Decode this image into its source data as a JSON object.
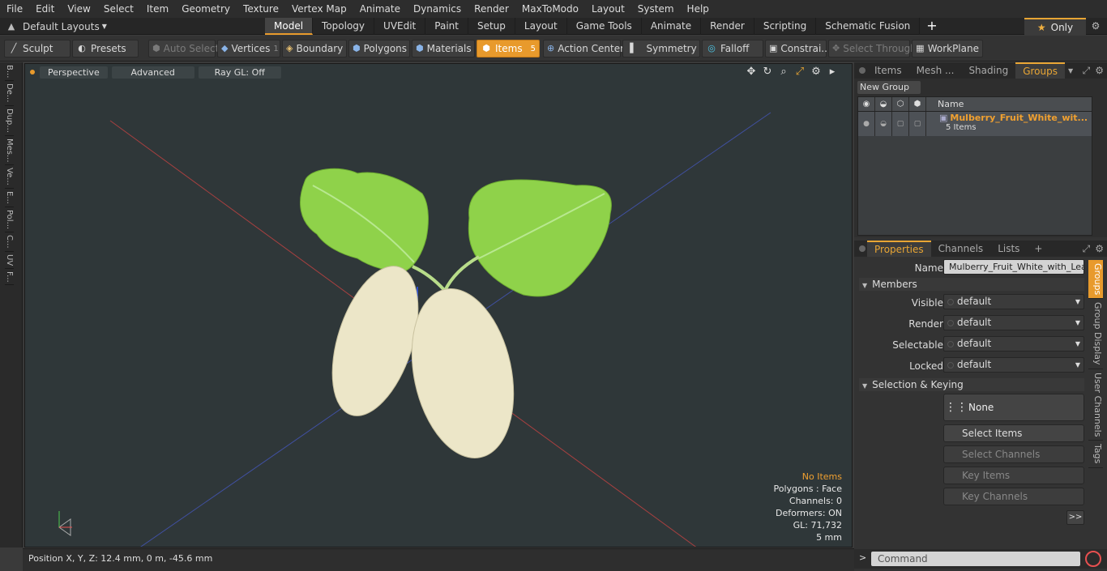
{
  "menubar": [
    "File",
    "Edit",
    "View",
    "Select",
    "Item",
    "Geometry",
    "Texture",
    "Vertex Map",
    "Animate",
    "Dynamics",
    "Render",
    "MaxToModo",
    "Layout",
    "System",
    "Help"
  ],
  "layouts": {
    "label": "Default Layouts"
  },
  "tabs": [
    {
      "label": "Model",
      "active": true
    },
    {
      "label": "Topology"
    },
    {
      "label": "UVEdit"
    },
    {
      "label": "Paint"
    },
    {
      "label": "Setup"
    },
    {
      "label": "Layout"
    },
    {
      "label": "Game Tools"
    },
    {
      "label": "Animate"
    },
    {
      "label": "Render"
    },
    {
      "label": "Scripting"
    },
    {
      "label": "Schematic Fusion"
    }
  ],
  "only_label": "Only",
  "toolbar": {
    "sculpt": "Sculpt",
    "presets": "Presets",
    "auto_select": "Auto Select",
    "vertices": "Vertices",
    "vertices_count": "1",
    "boundary": "Boundary",
    "polygons": "Polygons",
    "materials": "Materials",
    "items": "Items",
    "items_count": "5",
    "action_center": "Action Center",
    "symmetry": "Symmetry",
    "falloff": "Falloff",
    "constraints": "Constrai...",
    "select_through": "Select Through",
    "workplane": "WorkPlane"
  },
  "left_tabs": [
    "B...",
    "De...",
    "Dup...",
    "Mes...",
    "Ve...",
    "E...",
    "Pol...",
    "C...",
    "UV",
    "F..."
  ],
  "viewport": {
    "perspective": "Perspective",
    "advanced": "Advanced",
    "raygl": "Ray GL: Off",
    "info": {
      "no_items": "No Items",
      "polygons": "Polygons : Face",
      "channels": "Channels: 0",
      "deformers": "Deformers: ON",
      "gl": "GL: 71,732",
      "scale": "5 mm"
    }
  },
  "status": {
    "position": "Position X, Y, Z:   12.4 mm, 0 m, -45.6 mm"
  },
  "top_panel_tabs": [
    {
      "label": "Items"
    },
    {
      "label": "Mesh ..."
    },
    {
      "label": "Shading"
    },
    {
      "label": "Groups",
      "active": true
    }
  ],
  "groups": {
    "new_group": "New Group",
    "column_name": "Name",
    "item": {
      "name": "Mulberry_Fruit_White_wit...",
      "count": "5 Items"
    }
  },
  "props_tabs": [
    {
      "label": "Properties",
      "active": true
    },
    {
      "label": "Channels"
    },
    {
      "label": "Lists"
    }
  ],
  "properties": {
    "name_label": "Name",
    "name_value": "Mulberry_Fruit_White_with_Leaves",
    "members": "Members",
    "visible_label": "Visible",
    "visible_value": "default",
    "render_label": "Render",
    "render_value": "default",
    "selectable_label": "Selectable",
    "selectable_value": "default",
    "locked_label": "Locked",
    "locked_value": "default",
    "sel_keying": "Selection & Keying",
    "none": "None",
    "select_items": "Select Items",
    "select_channels": "Select Channels",
    "key_items": "Key Items",
    "key_channels": "Key Channels",
    "more": ">>"
  },
  "vertical_tabs": [
    {
      "label": "Groups",
      "active": true
    },
    {
      "label": "Group Display"
    },
    {
      "label": "User Channels"
    },
    {
      "label": "Tags"
    }
  ],
  "command": {
    "placeholder": "Command"
  },
  "colors": {
    "accent": "#e89a2c",
    "leaf": "#8fd24a",
    "fruit": "#ece6c8",
    "viewport_bg": "#2f3739"
  }
}
